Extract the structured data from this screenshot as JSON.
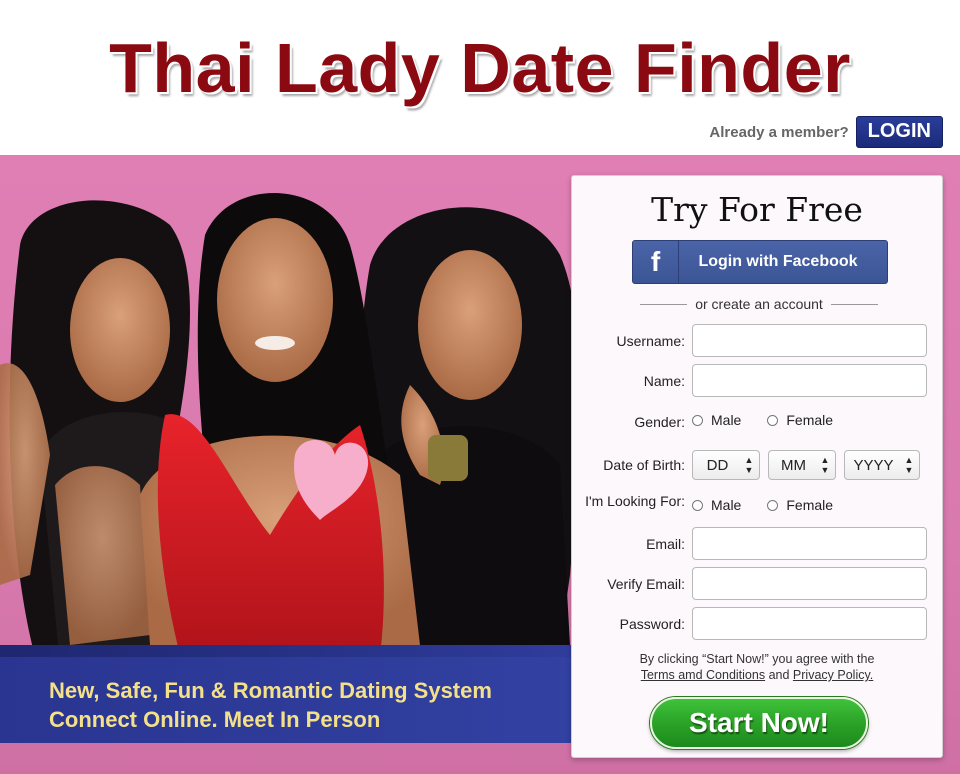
{
  "header": {
    "site_title": "Thai Lady Date Finder",
    "member_prompt": "Already a member?",
    "login_label": "LOGIN"
  },
  "hero": {
    "photo_icon": "three-women-portrait",
    "tagline_line1": "New, Safe, Fun & Romantic Dating System",
    "tagline_line2": "Connect Online. Meet In Person"
  },
  "form": {
    "title": "Try For Free",
    "facebook_icon": "f",
    "facebook_label": "Login with Facebook",
    "divider_text": "or create an account",
    "username_label": "Username:",
    "name_label": "Name:",
    "gender_label": "Gender:",
    "gender_options": [
      "Male",
      "Female"
    ],
    "dob_label": "Date of Birth:",
    "dob_day": "DD",
    "dob_month": "MM",
    "dob_year": "YYYY",
    "looking_for_label": "I'm Looking For:",
    "looking_for_options": [
      "Male",
      "Female"
    ],
    "email_label": "Email:",
    "verify_email_label": "Verify Email:",
    "password_label": "Password:",
    "terms_prefix": "By clicking “Start Now!” you agree with the",
    "terms_link": "Terms amd Conditions",
    "terms_and": "and",
    "privacy_link": "Privacy Policy.",
    "start_label": "Start Now!"
  },
  "colors": {
    "title_red": "#8b0a12",
    "login_blue": "#1b2b7a",
    "hero_pink": "#d97aae",
    "tagline_band": "#2f3d9c",
    "tagline_text": "#f5e08a",
    "facebook_blue": "#3b5594",
    "start_green": "#2aa026"
  }
}
